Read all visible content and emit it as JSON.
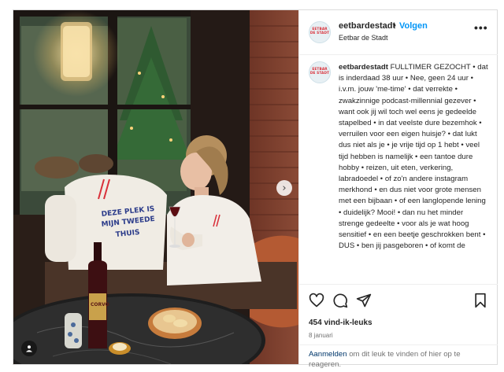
{
  "account": {
    "username": "eetbardestadt",
    "separator": "•",
    "follow_label": "Volgen",
    "subtitle": "Eetbar de Stadt",
    "avatar_logo_line1": "EETBAR",
    "avatar_logo_line2": "DE STADT",
    "more_label": "•••"
  },
  "caption": {
    "username": "eetbardestadt",
    "text": "FULLTIMER GEZOCHT • dat is inderdaad 38 uur • Nee, geen 24 uur • i.v.m. jouw 'me-time' • dat verrekte • zwakzinnige podcast-millennial gezever • want ook jij wil toch wel eens je gedeelde stapelbed • in dat veelste dure bezemhok • verruilen voor een eigen huisje? • dat lukt dus niet als je • je vrije tijd op 1 hebt • veel tijd hebben is namelijk • een tantoe dure hobby • reizen, uit eten, verkering, labradoedel • of zo'n andere instagram merkhond • en dus niet voor grote mensen met een bijbaan • of een langlopende lening • duidelijk? Mooi! • dan nu het minder strenge gedeelte • voor als je wat hoog sensitief • en een beetje geschrokken bent • DUS • ben jij pasgeboren • of komt de"
  },
  "photo": {
    "sweater_line1": "DEZE PLEK IS",
    "sweater_line2": "MIJN TWEEDE",
    "sweater_line3": "THUIS",
    "wine_label": "CORVO",
    "next_icon": "›"
  },
  "actions": {
    "likes": "454 vind-ik-leuks",
    "date": "8 januari"
  },
  "login": {
    "link": "Aanmelden",
    "text": " om dit leuk te vinden of hier op te reageren."
  },
  "colors": {
    "accent": "#0095f6",
    "logo_red": "#d9303a",
    "link_dark": "#00376b"
  }
}
